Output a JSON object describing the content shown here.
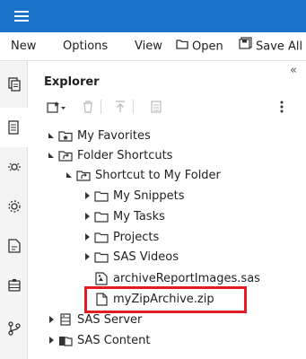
{
  "menu": {
    "new_label": "New",
    "options_label": "Options",
    "view_label": "View",
    "open_label": "Open",
    "save_all_label": "Save All"
  },
  "panel": {
    "title": "Explorer"
  },
  "tree": {
    "my_favorites": "My Favorites",
    "folder_shortcuts": "Folder Shortcuts",
    "shortcut_to_my_folder": "Shortcut to My Folder",
    "my_snippets": "My Snippets",
    "my_tasks": "My Tasks",
    "projects": "Projects",
    "sas_videos": "SAS Videos",
    "archive_report_images": "archiveReportImages.sas",
    "my_zip_archive": "myZipArchive.zip",
    "sas_server": "SAS Server",
    "sas_content": "SAS Content"
  },
  "colors": {
    "topbar": "#1a73c8",
    "highlight": "#e41b23"
  }
}
